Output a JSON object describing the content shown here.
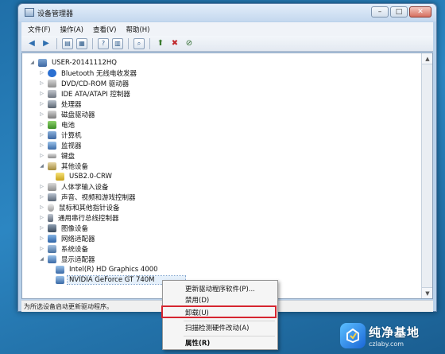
{
  "window": {
    "title": "设备管理器",
    "buttons": [
      "–",
      "□",
      "✕"
    ]
  },
  "menubar": [
    "文件(F)",
    "操作(A)",
    "查看(V)",
    "帮助(H)"
  ],
  "tree": {
    "root": "USER-20141112HQ",
    "categories": [
      "Bluetooth 无线电收发器",
      "DVD/CD-ROM 驱动器",
      "IDE ATA/ATAPI 控制器",
      "处理器",
      "磁盘驱动器",
      "电池",
      "计算机",
      "监视器",
      "键盘",
      "其他设备",
      "USB2.0-CRW",
      "人体学输入设备",
      "声音、视频和游戏控制器",
      "鼠标和其他指针设备",
      "通用串行总线控制器",
      "图像设备",
      "网络适配器",
      "系统设备",
      "显示适配器",
      "Intel(R) HD Graphics 4000",
      "NVIDIA GeForce GT 740M"
    ]
  },
  "status": "为所选设备启动更新驱动程序。",
  "context_menu": {
    "update": "更新驱动程序软件(P)...",
    "disable": "禁用(D)",
    "uninstall": "卸载(U)",
    "scan": "扫描检测硬件改动(A)",
    "properties": "属性(R)"
  },
  "watermark": {
    "title": "纯净基地",
    "url": "czlaby.com"
  },
  "colors": {
    "highlight_border": "#d6252f",
    "selection": "#e5f0fb"
  }
}
